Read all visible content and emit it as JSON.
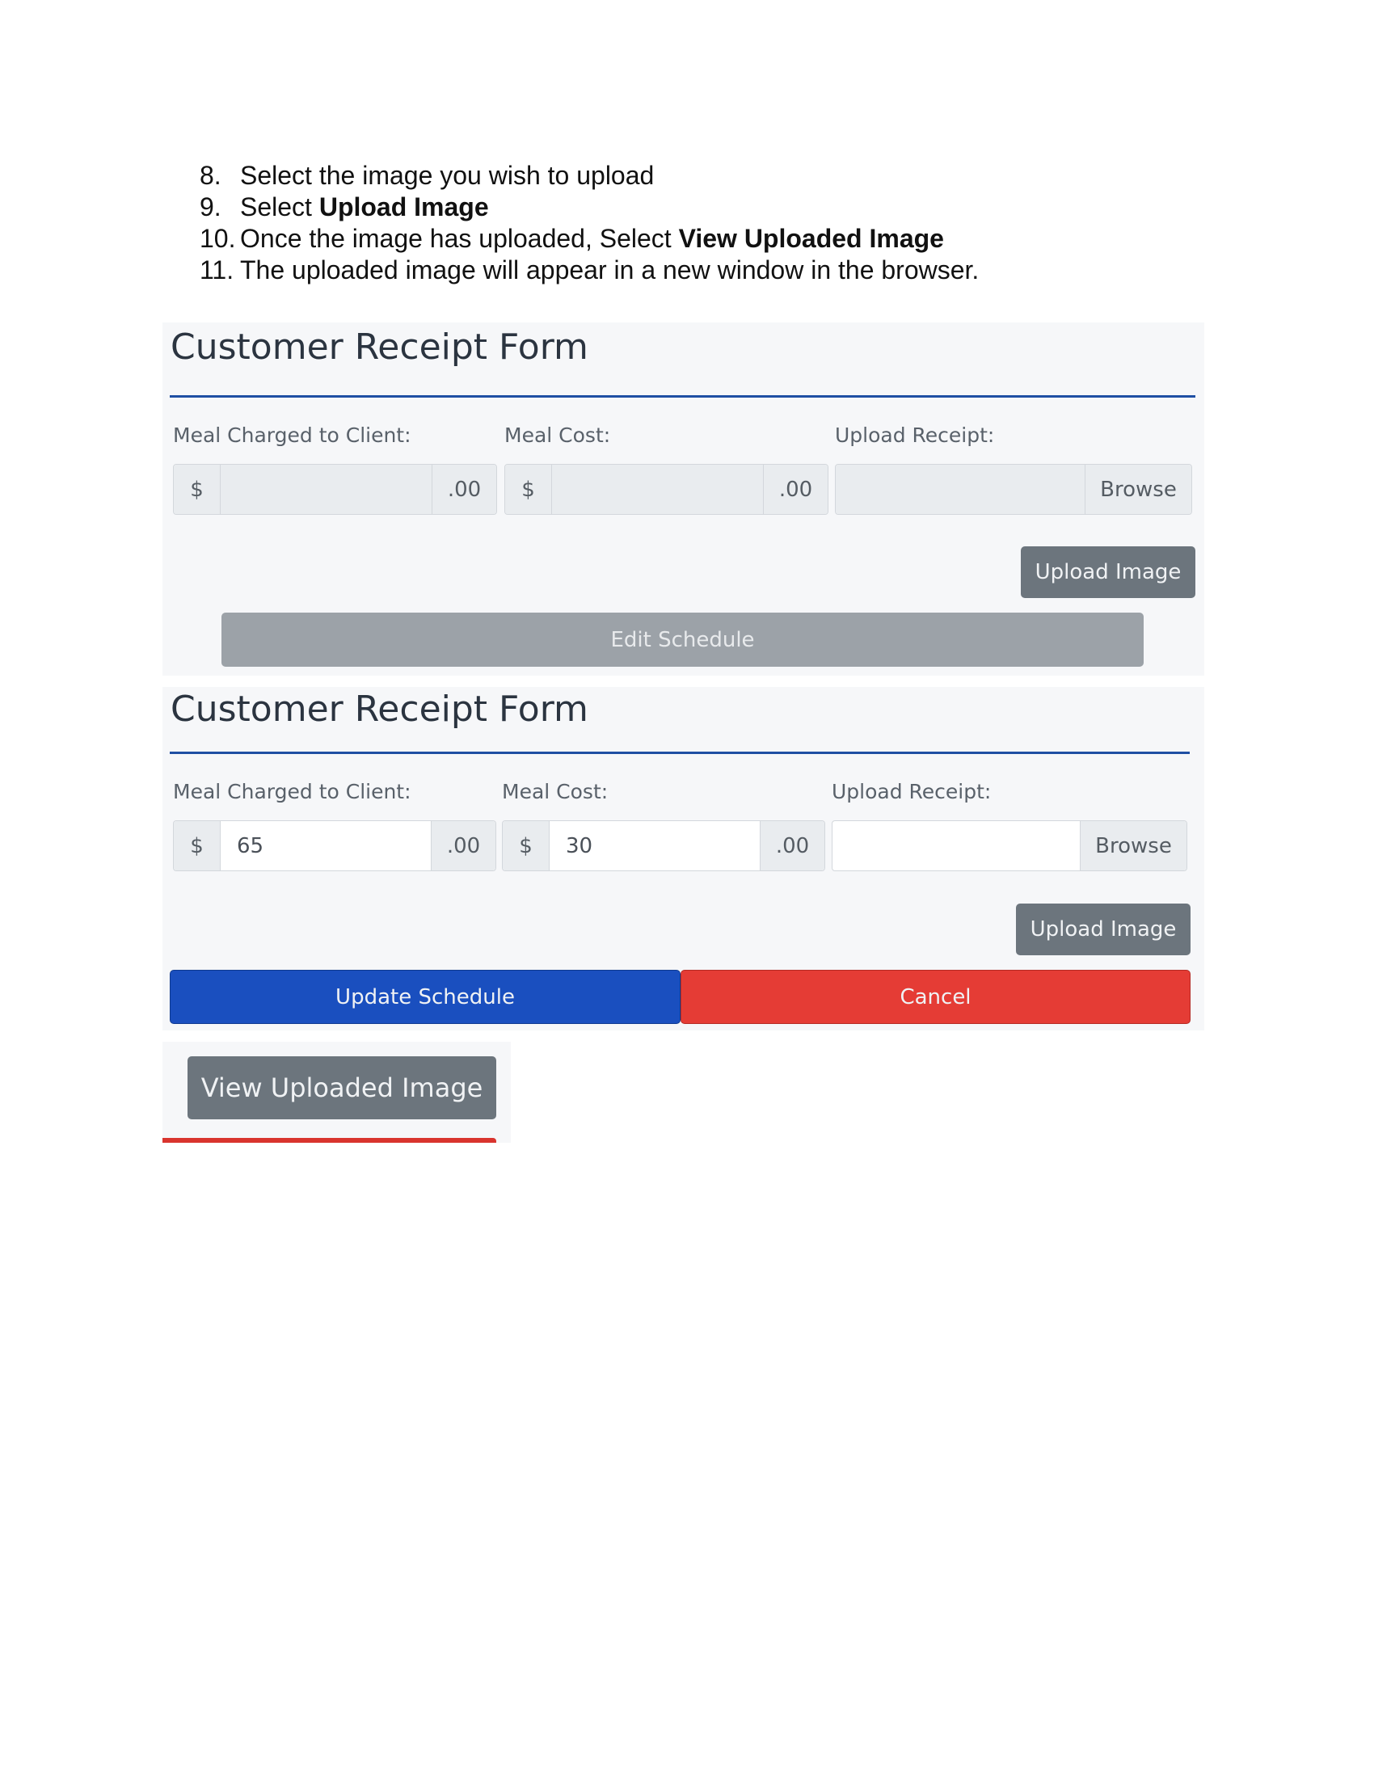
{
  "steps": [
    {
      "num": "8.",
      "text": "Select the image you wish to upload",
      "bold": ""
    },
    {
      "num": "9.",
      "text": "Select ",
      "bold": "Upload Image"
    },
    {
      "num": "10.",
      "text": "Once the image has uploaded, Select ",
      "bold": "View Uploaded Image"
    },
    {
      "num": "11.",
      "text": "The uploaded image will appear in a new window in the browser.",
      "bold": ""
    }
  ],
  "form1": {
    "title": "Customer Receipt Form",
    "label_charged": "Meal Charged to Client:",
    "label_cost": "Meal Cost:",
    "label_upload": "Upload Receipt:",
    "currency": "$",
    "cents": ".00",
    "charged_value": "",
    "cost_value": "",
    "browse": "Browse",
    "upload_button": "Upload Image",
    "edit_button": "Edit Schedule"
  },
  "form2": {
    "title": "Customer Receipt Form",
    "label_charged": "Meal Charged to Client:",
    "label_cost": "Meal Cost:",
    "label_upload": "Upload Receipt:",
    "currency": "$",
    "cents": ".00",
    "charged_value": "65",
    "cost_value": "30",
    "browse": "Browse",
    "upload_button": "Upload Image",
    "update_button": "Update Schedule",
    "cancel_button": "Cancel"
  },
  "view_button": "View Uploaded Image",
  "colors": {
    "primary": "#1a4fbf",
    "danger": "#e53c35",
    "secondary": "#6c757d"
  }
}
